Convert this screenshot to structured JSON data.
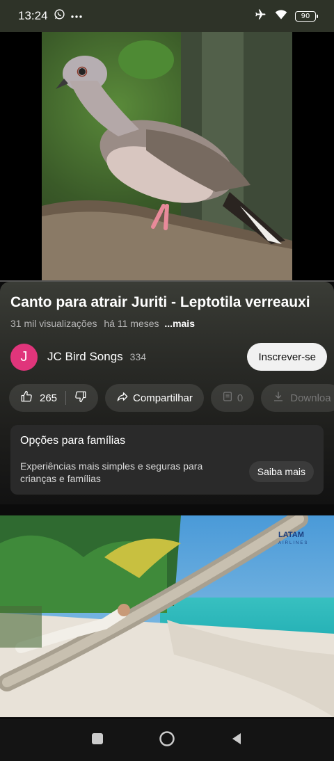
{
  "status_bar": {
    "time": "13:24",
    "battery": "90",
    "icons": [
      "whatsapp-icon",
      "more-dots-icon",
      "airplane-mode-icon",
      "wifi-icon",
      "battery-icon"
    ]
  },
  "video": {
    "thumbnail": "dove-perched-on-branch"
  },
  "info": {
    "title": "Canto para atrair Juriti - Leptotila verreauxi",
    "views": "31 mil visualizações",
    "age": "há 11 meses",
    "more": "...mais"
  },
  "channel": {
    "avatar_letter": "J",
    "avatar_color": "#e0357b",
    "name": "JC Bird Songs",
    "subscribers": "334",
    "subscribe_label": "Inscrever-se"
  },
  "actions": {
    "likes": "265",
    "share_label": "Compartilhar",
    "comments": "0",
    "download_label": "Downloa"
  },
  "family_card": {
    "title": "Opções para famílias",
    "description": "Experiências mais simples e seguras para crianças e famílias",
    "button_label": "Saiba mais"
  },
  "ad": {
    "brand": "LATAM",
    "brand_sub": "AIRLINES"
  },
  "nav": {
    "icons": [
      "recents-square-icon",
      "home-circle-icon",
      "back-triangle-icon"
    ]
  }
}
